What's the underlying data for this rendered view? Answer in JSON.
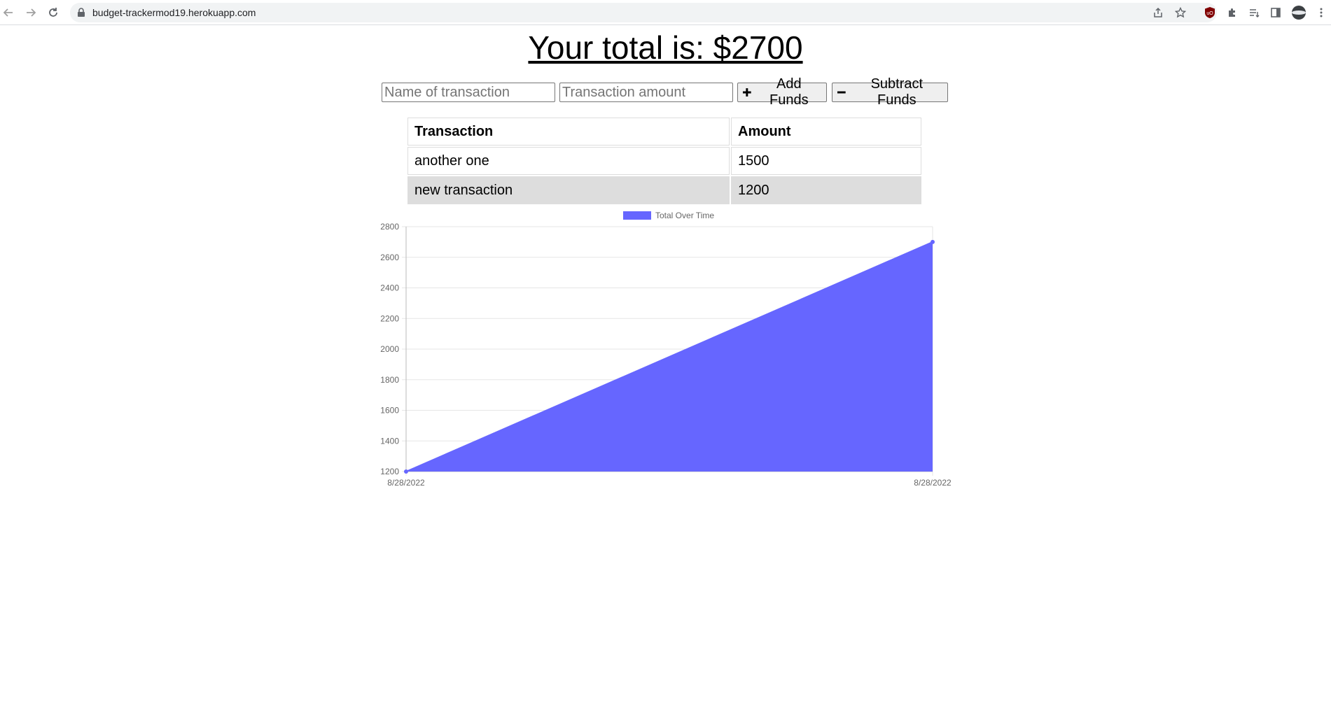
{
  "browser": {
    "url": "budget-trackermod19.herokuapp.com",
    "icons": [
      "back-icon",
      "forward-icon",
      "reload-icon",
      "lock-icon",
      "share-icon",
      "star-icon",
      "ublock-icon",
      "puzzle-icon",
      "reading-list-icon",
      "side-panel-icon",
      "profile-avatar",
      "more-icon"
    ]
  },
  "page": {
    "total_text": "Your total is: $2700",
    "name_placeholder": "Name of transaction",
    "amount_placeholder": "Transaction amount",
    "add_button": "Add Funds",
    "subtract_button": "Subtract Funds"
  },
  "table": {
    "headers": [
      "Transaction",
      "Amount"
    ],
    "rows": [
      {
        "name": "another one",
        "amount": "1500"
      },
      {
        "name": "new transaction",
        "amount": "1200"
      }
    ]
  },
  "chart_data": {
    "type": "area",
    "x": [
      "8/28/2022",
      "8/28/2022"
    ],
    "series": [
      {
        "name": "Total Over Time",
        "values": [
          1200,
          2700
        ],
        "color": "#6666ff"
      }
    ],
    "ylim": [
      1200,
      2800
    ],
    "yticks": [
      1200,
      1400,
      1600,
      1800,
      2000,
      2200,
      2400,
      2600,
      2800
    ],
    "grid": true,
    "legend": "top-center",
    "title": "",
    "xlabel": "",
    "ylabel": ""
  }
}
